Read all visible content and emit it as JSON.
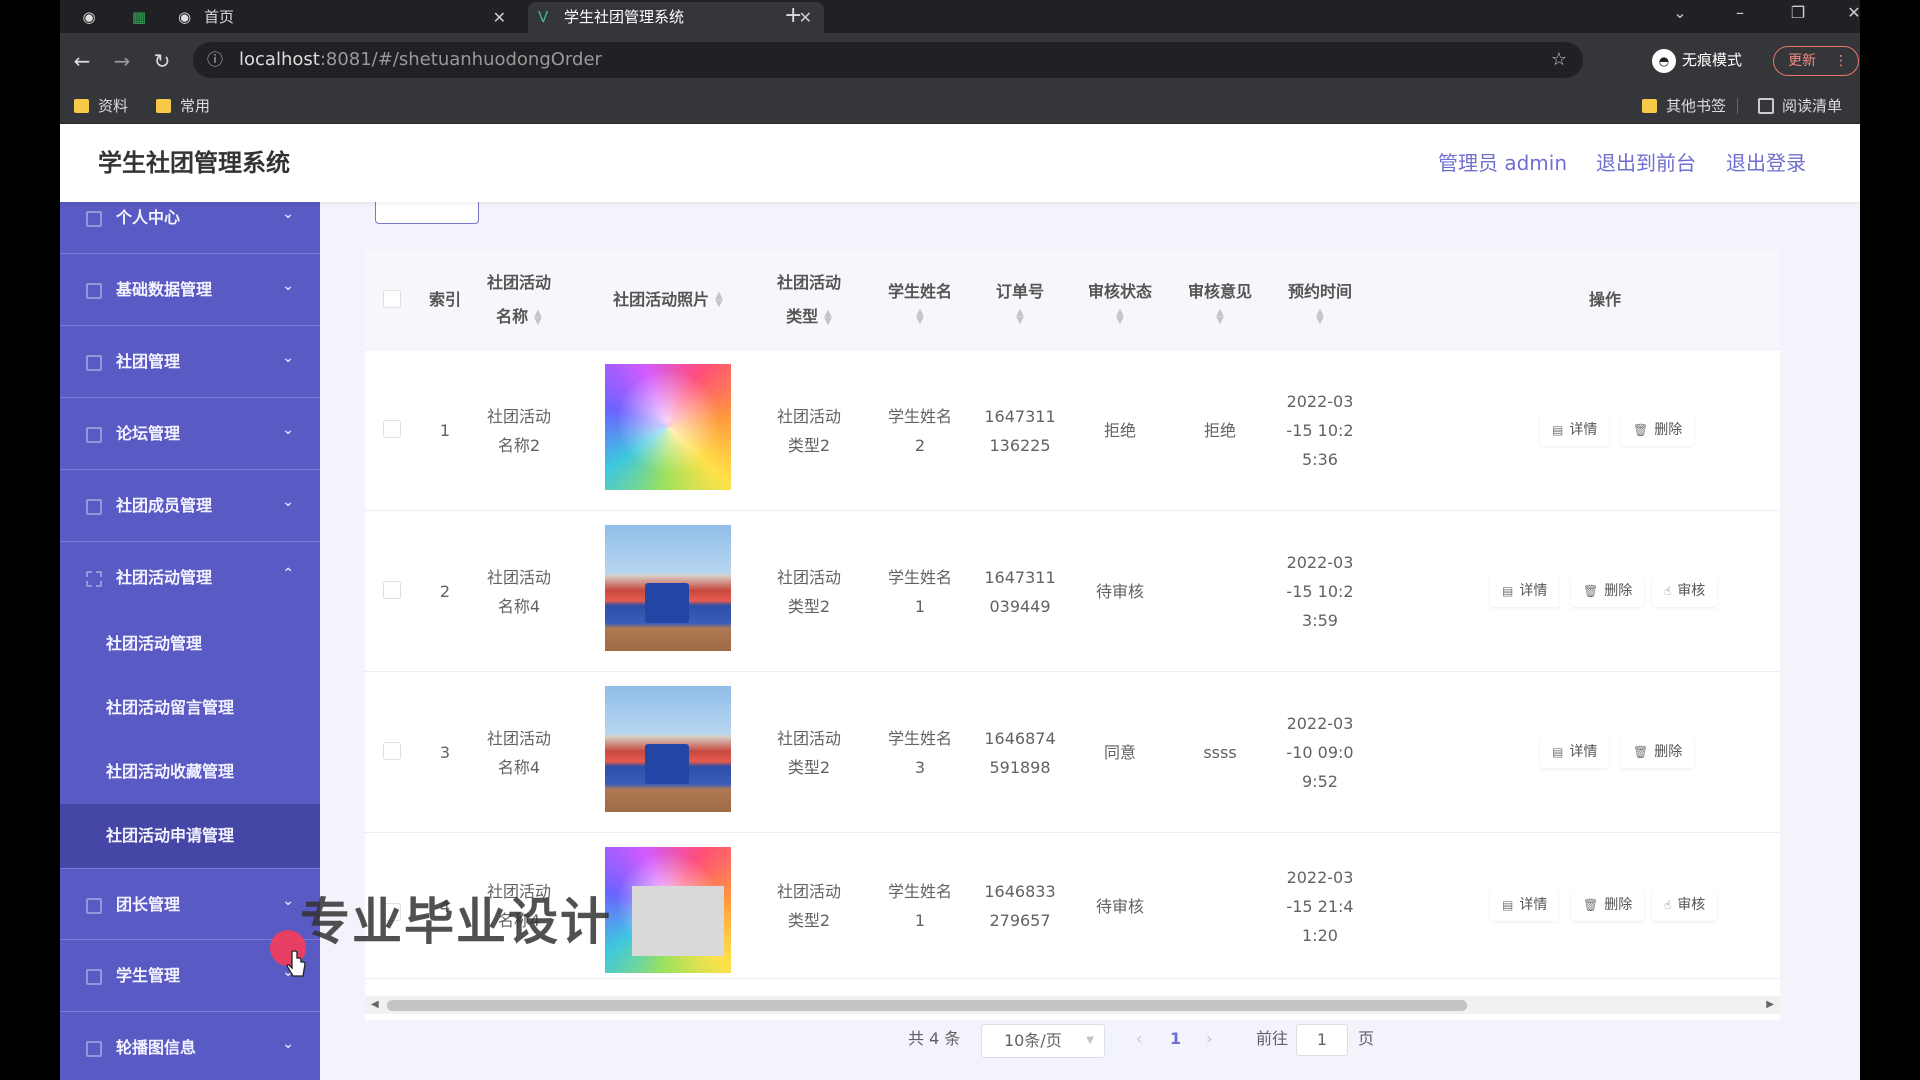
{
  "browser": {
    "tabs": [
      {
        "label": "首页",
        "active": false
      },
      {
        "label": "学生社团管理系统",
        "active": true
      }
    ],
    "url_host": "localhost",
    "url_path": ":8081/#/shetuanhuodongOrder",
    "incognito_label": "无痕模式",
    "update_label": "更新",
    "bookmarks": [
      "资料",
      "常用"
    ],
    "bookmarks_right": [
      "其他书签",
      "阅读清单"
    ]
  },
  "header": {
    "title": "学生社团管理系统",
    "user": "管理员 admin",
    "to_front": "退出到前台",
    "logout": "退出登录"
  },
  "sidebar": {
    "items": [
      {
        "label": "个人中心",
        "expanded": false
      },
      {
        "label": "基础数据管理",
        "expanded": false
      },
      {
        "label": "社团管理",
        "expanded": false
      },
      {
        "label": "论坛管理",
        "expanded": false
      },
      {
        "label": "社团成员管理",
        "expanded": false
      },
      {
        "label": "社团活动管理",
        "expanded": true
      },
      {
        "label": "团长管理",
        "expanded": false
      },
      {
        "label": "学生管理",
        "expanded": false
      },
      {
        "label": "轮播图信息",
        "expanded": false
      }
    ],
    "subitems": [
      {
        "label": "社团活动管理",
        "active": false
      },
      {
        "label": "社团活动留言管理",
        "active": false
      },
      {
        "label": "社团活动收藏管理",
        "active": false
      },
      {
        "label": "社团活动申请管理",
        "active": true
      }
    ]
  },
  "table": {
    "headers": {
      "index": "索引",
      "name_1": "社团活动",
      "name_2": "名称",
      "photo": "社团活动照片",
      "type_1": "社团活动",
      "type_2": "类型",
      "student": "学生姓名",
      "order": "订单号",
      "status": "审核状态",
      "opinion": "审核意见",
      "time": "预约时间",
      "ops": "操作"
    },
    "rows": [
      {
        "index": "1",
        "name_1": "社团活动",
        "name_2": "名称2",
        "photo": "color",
        "type_1": "社团活动",
        "type_2": "类型2",
        "student_1": "学生姓名",
        "student_2": "2",
        "order_1": "1647311",
        "order_2": "136225",
        "status": "拒绝",
        "opinion": "拒绝",
        "time_1": "2022-03",
        "time_2": "-15 10:2",
        "time_3": "5:36",
        "can_review": false
      },
      {
        "index": "2",
        "name_1": "社团活动",
        "name_2": "名称4",
        "photo": "team",
        "type_1": "社团活动",
        "type_2": "类型2",
        "student_1": "学生姓名",
        "student_2": "1",
        "order_1": "1647311",
        "order_2": "039449",
        "status": "待审核",
        "opinion": "",
        "time_1": "2022-03",
        "time_2": "-15 10:2",
        "time_3": "3:59",
        "can_review": true
      },
      {
        "index": "3",
        "name_1": "社团活动",
        "name_2": "名称4",
        "photo": "team",
        "type_1": "社团活动",
        "type_2": "类型2",
        "student_1": "学生姓名",
        "student_2": "3",
        "order_1": "1646874",
        "order_2": "591898",
        "status": "同意",
        "opinion": "ssss",
        "time_1": "2022-03",
        "time_2": "-10 09:0",
        "time_3": "9:52",
        "can_review": false
      },
      {
        "index": "4",
        "name_1": "社团活动",
        "name_2": "名称4",
        "photo": "color",
        "type_1": "社团活动",
        "type_2": "类型2",
        "student_1": "学生姓名",
        "student_2": "1",
        "order_1": "1646833",
        "order_2": "279657",
        "status": "待审核",
        "opinion": "",
        "time_1": "2022-03",
        "time_2": "-15 21:4",
        "time_3": "1:20",
        "can_review": true
      }
    ],
    "op_labels": {
      "detail": "详情",
      "delete": "删除",
      "review": "审核"
    }
  },
  "pagination": {
    "total": "共 4 条",
    "page_size": "10条/页",
    "current": "1",
    "goto_prefix": "前往",
    "goto_value": "1",
    "goto_suffix": "页"
  },
  "overlay": {
    "watermark": "专业毕业设计"
  },
  "colors": {
    "sidebar": "#5a5ac4",
    "sidebar_active": "#4646a6",
    "accent": "#6f6fd0"
  }
}
